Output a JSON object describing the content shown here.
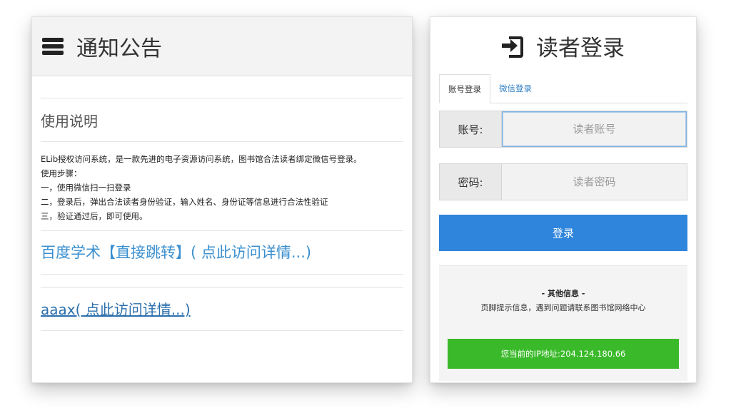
{
  "notice": {
    "title": "通知公告",
    "usage_title": "使用说明",
    "usage_lines": [
      "ELib授权访问系统，是一款先进的电子资源访问系统，图书馆合法读者绑定微信号登录。",
      "使用步骤：",
      "一，使用微信扫一扫登录",
      "二，登录后，弹出合法读者身份验证，输入姓名、身份证等信息进行合法性验证",
      "三，验证通过后，即可使用。"
    ],
    "link_baidu": "百度学术【直接跳转】( 点此访问详情...)",
    "link_aaax": "aaax( 点此访问详情...)"
  },
  "login": {
    "title": "读者登录",
    "tabs": [
      {
        "label": "账号登录",
        "active": true
      },
      {
        "label": "微信登录",
        "active": false
      }
    ],
    "account_label": "账号:",
    "account_placeholder": "读者账号",
    "account_value": "",
    "password_label": "密码:",
    "password_placeholder": "读者密码",
    "password_value": "",
    "submit_label": "登录",
    "other_title": "- 其他信息 -",
    "other_text": "页脚提示信息，遇到问题请联系图书馆网络中心",
    "ip_text": "您当前的IP地址:204.124.180.66"
  },
  "colors": {
    "primary_button": "#2f85dc",
    "ip_bar": "#3aba2a",
    "link": "#3a8fcf",
    "tab_link": "#2f7fc4"
  },
  "icons": {
    "notice": "list-icon",
    "login": "sign-in-icon"
  }
}
